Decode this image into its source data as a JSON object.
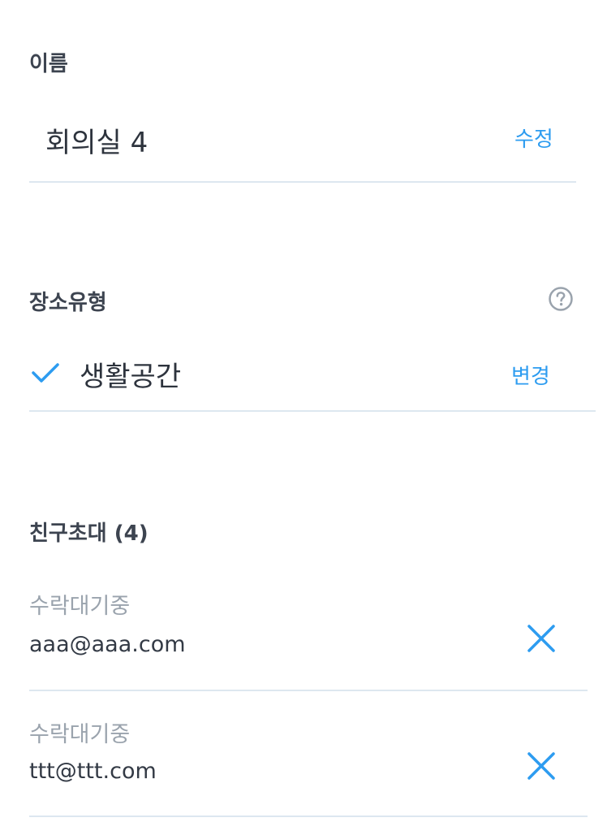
{
  "name_section": {
    "label": "이름",
    "value": "회의실 4",
    "edit_label": "수정"
  },
  "place_type_section": {
    "label": "장소유형",
    "help_icon": "question-circle-icon",
    "value": "생활공간",
    "selected_icon": "checkmark-icon",
    "change_label": "변경"
  },
  "invite_section": {
    "label": "친구초대 (4)",
    "invites": [
      {
        "status": "수락대기중",
        "email": "aaa@aaa.com",
        "remove_icon": "close-icon"
      },
      {
        "status": "수락대기중",
        "email": "ttt@ttt.com",
        "remove_icon": "close-icon"
      }
    ]
  },
  "colors": {
    "accent": "#2d9cf0",
    "divider": "#dde7f0",
    "label": "#3d4450",
    "muted": "#9aa3ad"
  }
}
